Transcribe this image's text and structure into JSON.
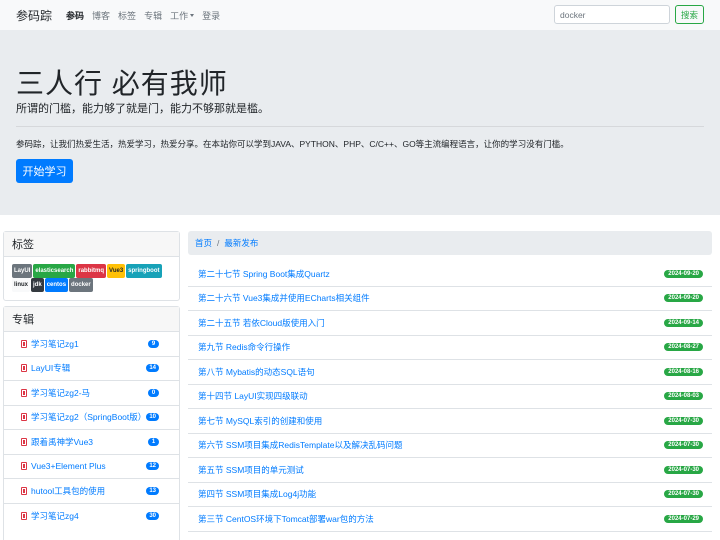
{
  "nav": {
    "brand": "参码踪",
    "items": [
      {
        "label": "参码",
        "active": true
      },
      {
        "label": "博客",
        "active": false
      },
      {
        "label": "标签",
        "active": false
      },
      {
        "label": "专辑",
        "active": false
      },
      {
        "label": "工作",
        "active": false,
        "dropdown": true
      },
      {
        "label": "登录",
        "active": false
      }
    ],
    "search_value": "docker",
    "search_button": "搜索"
  },
  "jumbotron": {
    "title": "三人行 必有我师",
    "lead": "所谓的门槛，能力够了就是门，能力不够那就是槛。",
    "description": "参码踪，让我们热爱生活，热爱学习，热爱分享。在本站你可以学到JAVA、PYTHON、PHP、C/C++、GO等主流编程语言，让你的学习没有门槛。",
    "button": "开始学习"
  },
  "tags": {
    "title": "标签",
    "items": [
      {
        "label": "LayUI",
        "color": "#6c757d",
        "text_color": "#ffffff"
      },
      {
        "label": "elasticsearch",
        "color": "#28a745",
        "text_color": "#ffffff"
      },
      {
        "label": "rabbitmq",
        "color": "#dc3545",
        "text_color": "#ffffff"
      },
      {
        "label": "Vue3",
        "color": "#ffc107",
        "text_color": "#212529"
      },
      {
        "label": "springboot",
        "color": "#17a2b8",
        "text_color": "#ffffff"
      },
      {
        "label": "linux",
        "color": "#f8f9fa",
        "text_color": "#212529"
      },
      {
        "label": "jdk",
        "color": "#343a40",
        "text_color": "#ffffff"
      },
      {
        "label": "centos",
        "color": "#007bff",
        "text_color": "#ffffff"
      },
      {
        "label": "docker",
        "color": "#6c757d",
        "text_color": "#ffffff"
      }
    ]
  },
  "albums": {
    "title": "专辑",
    "items": [
      {
        "label": "学习笔记zg1",
        "count": "9"
      },
      {
        "label": "LayUI专辑",
        "count": "14"
      },
      {
        "label": "学习笔记zg2-马",
        "count": "0"
      },
      {
        "label": "学习笔记zg2（SpringBoot版）",
        "count": "10"
      },
      {
        "label": "跟着禹神学Vue3",
        "count": "1"
      },
      {
        "label": "Vue3+Element Plus",
        "count": "12"
      },
      {
        "label": "hutool工具包的使用",
        "count": "13"
      },
      {
        "label": "学习笔记zg4",
        "count": "30"
      }
    ]
  },
  "breadcrumb": {
    "home": "首页",
    "separator": "/",
    "current": "最新发布"
  },
  "posts": [
    {
      "title": "第二十七节 Spring Boot集成Quartz",
      "date": "2024-09-20"
    },
    {
      "title": "第二十六节 Vue3集成并使用ECharts相关组件",
      "date": "2024-09-20"
    },
    {
      "title": "第二十五节 若依Cloud版使用入门",
      "date": "2024-09-14"
    },
    {
      "title": "第九节 Redis命令行操作",
      "date": "2024-08-27"
    },
    {
      "title": "第八节 Mybatis的动态SQL语句",
      "date": "2024-08-16"
    },
    {
      "title": "第十四节 LayUI实现四级联动",
      "date": "2024-08-03"
    },
    {
      "title": "第七节 MySQL索引的创建和使用",
      "date": "2024-07-30"
    },
    {
      "title": "第六节 SSM项目集成RedisTemplate以及解决乱码问题",
      "date": "2024-07-30"
    },
    {
      "title": "第五节 SSM项目的单元测试",
      "date": "2024-07-30"
    },
    {
      "title": "第四节 SSM项目集成Log4j功能",
      "date": "2024-07-30"
    },
    {
      "title": "第三节 CentOS环境下Tomcat部署war包的方法",
      "date": "2024-07-29"
    }
  ]
}
